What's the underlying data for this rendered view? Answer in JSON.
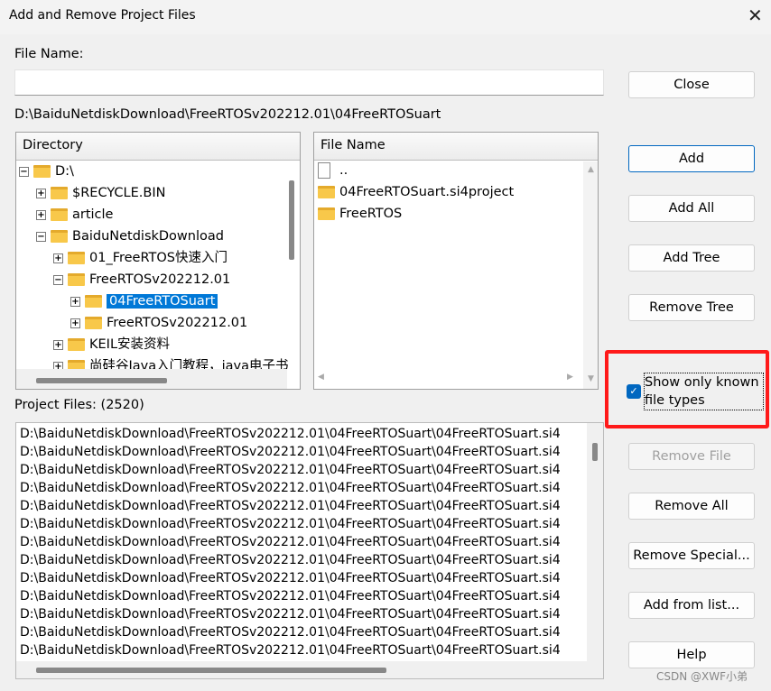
{
  "window": {
    "title": "Add and Remove Project Files",
    "close_glyph": "✕"
  },
  "file_name": {
    "label": "File Name:",
    "value": ""
  },
  "current_path": "D:\\BaiduNetdiskDownload\\FreeRTOSv202212.01\\04FreeRTOSuart",
  "directory": {
    "header": "Directory",
    "items": [
      {
        "label": "D:\\",
        "toggle": "−",
        "level": 0
      },
      {
        "label": "$RECYCLE.BIN",
        "toggle": "+",
        "level": 1
      },
      {
        "label": "article",
        "toggle": "+",
        "level": 1
      },
      {
        "label": "BaiduNetdiskDownload",
        "toggle": "−",
        "level": 1
      },
      {
        "label": "01_FreeRTOS快速入门",
        "toggle": "+",
        "level": 2
      },
      {
        "label": "FreeRTOSv202212.01",
        "toggle": "−",
        "level": 2
      },
      {
        "label": "04FreeRTOSuart",
        "toggle": "+",
        "level": 3,
        "selected": true
      },
      {
        "label": "FreeRTOSv202212.01",
        "toggle": "+",
        "level": 3
      },
      {
        "label": "KEIL安装资料",
        "toggle": "+",
        "level": 2
      },
      {
        "label": "尚硅谷Java入门教程，java电子书",
        "toggle": "+",
        "level": 2
      }
    ]
  },
  "files": {
    "header": "File Name",
    "items": [
      {
        "label": "..",
        "icon": "file"
      },
      {
        "label": "04FreeRTOSuart.si4project",
        "icon": "folder"
      },
      {
        "label": "FreeRTOS",
        "icon": "folder"
      }
    ]
  },
  "project_files": {
    "label": "Project Files: (2520)",
    "items": [
      "D:\\BaiduNetdiskDownload\\FreeRTOSv202212.01\\04FreeRTOSuart\\04FreeRTOSuart.si4",
      "D:\\BaiduNetdiskDownload\\FreeRTOSv202212.01\\04FreeRTOSuart\\04FreeRTOSuart.si4",
      "D:\\BaiduNetdiskDownload\\FreeRTOSv202212.01\\04FreeRTOSuart\\04FreeRTOSuart.si4",
      "D:\\BaiduNetdiskDownload\\FreeRTOSv202212.01\\04FreeRTOSuart\\04FreeRTOSuart.si4",
      "D:\\BaiduNetdiskDownload\\FreeRTOSv202212.01\\04FreeRTOSuart\\04FreeRTOSuart.si4",
      "D:\\BaiduNetdiskDownload\\FreeRTOSv202212.01\\04FreeRTOSuart\\04FreeRTOSuart.si4",
      "D:\\BaiduNetdiskDownload\\FreeRTOSv202212.01\\04FreeRTOSuart\\04FreeRTOSuart.si4",
      "D:\\BaiduNetdiskDownload\\FreeRTOSv202212.01\\04FreeRTOSuart\\04FreeRTOSuart.si4",
      "D:\\BaiduNetdiskDownload\\FreeRTOSv202212.01\\04FreeRTOSuart\\04FreeRTOSuart.si4",
      "D:\\BaiduNetdiskDownload\\FreeRTOSv202212.01\\04FreeRTOSuart\\04FreeRTOSuart.si4",
      "D:\\BaiduNetdiskDownload\\FreeRTOSv202212.01\\04FreeRTOSuart\\04FreeRTOSuart.si4",
      "D:\\BaiduNetdiskDownload\\FreeRTOSv202212.01\\04FreeRTOSuart\\04FreeRTOSuart.si4",
      "D:\\BaiduNetdiskDownload\\FreeRTOSv202212.01\\04FreeRTOSuart\\04FreeRTOSuart.si4"
    ]
  },
  "buttons": {
    "close": "Close",
    "add": "Add",
    "add_all": "Add All",
    "add_tree": "Add Tree",
    "remove_tree": "Remove Tree",
    "remove_file": "Remove File",
    "remove_all": "Remove All",
    "remove_special": "Remove Special...",
    "add_from_list": "Add from list...",
    "help": "Help"
  },
  "checkbox": {
    "label": "Show only known file types",
    "checked": true
  },
  "highlight_color": "#ff1a1a",
  "watermark": "CSDN @XWF小弟"
}
